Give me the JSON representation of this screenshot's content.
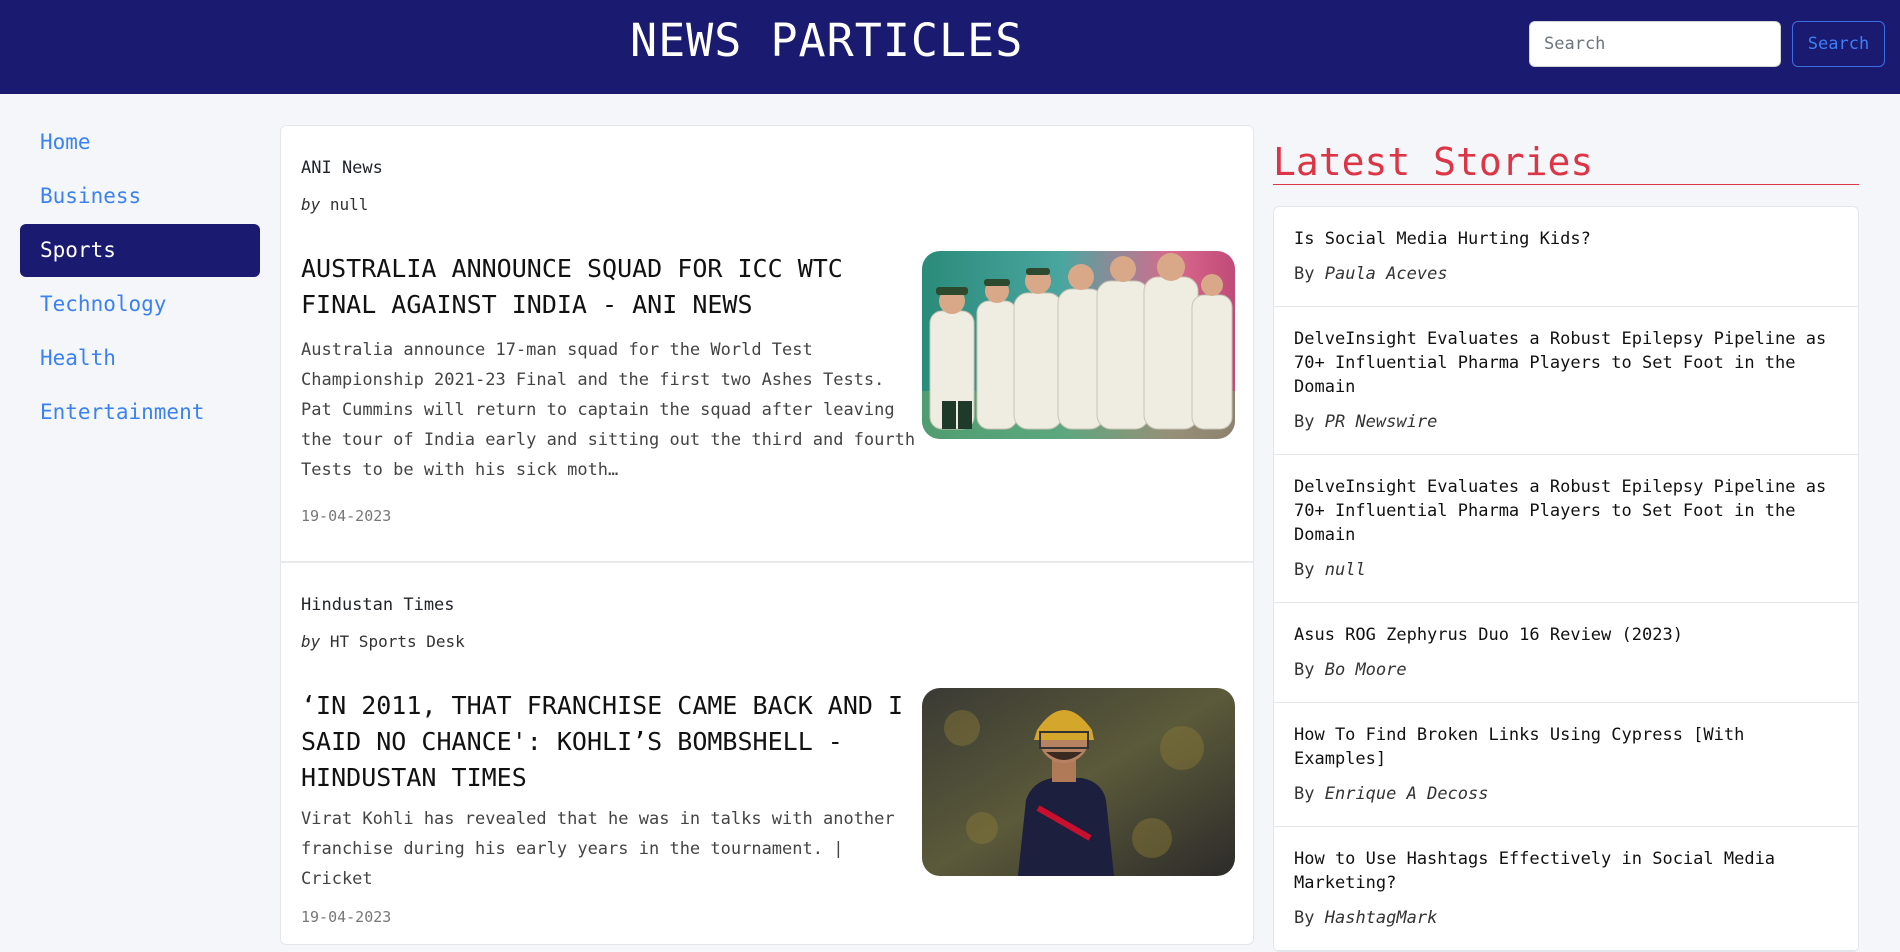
{
  "header": {
    "brand": "NEWS PARTICLES",
    "search_placeholder": "Search",
    "search_button": "Search"
  },
  "sidebar": {
    "items": [
      {
        "label": "Home"
      },
      {
        "label": "Business"
      },
      {
        "label": "Sports"
      },
      {
        "label": "Technology"
      },
      {
        "label": "Health"
      },
      {
        "label": "Entertainment"
      }
    ],
    "active": "Sports"
  },
  "articles": [
    {
      "source": "ANI News",
      "by_prefix": "by",
      "author": "null",
      "title": "AUSTRALIA ANNOUNCE SQUAD FOR ICC WTC FINAL AGAINST INDIA - ANI NEWS",
      "description": "Australia announce 17-man squad for the World Test Championship 2021-23 Final and the first two Ashes Tests. Pat Cummins will return to captain the squad after leaving the tour of India early and sitting out the third and fourth Tests to be with his sick moth…",
      "date": "19-04-2023"
    },
    {
      "source": "Hindustan Times",
      "by_prefix": "by",
      "author": "HT Sports Desk",
      "title": "‘IN 2011, THAT FRANCHISE CAME BACK AND I SAID NO CHANCE': KOHLI’S BOMBSHELL - HINDUSTAN TIMES",
      "description": "Virat Kohli has revealed that he was in talks with another franchise during his early years in the tournament. | Cricket",
      "date": "19-04-2023"
    }
  ],
  "latest": {
    "heading": "Latest Stories",
    "by_prefix": "By",
    "stories": [
      {
        "title": "Is Social Media Hurting Kids?",
        "author": "Paula Aceves"
      },
      {
        "title": "DelveInsight Evaluates a Robust Epilepsy Pipeline as 70+ Influential Pharma Players to Set Foot in the Domain",
        "author": "PR Newswire"
      },
      {
        "title": "DelveInsight Evaluates a Robust Epilepsy Pipeline as 70+ Influential Pharma Players to Set Foot in the Domain",
        "author": "null"
      },
      {
        "title": "Asus ROG Zephyrus Duo 16 Review (2023)",
        "author": "Bo Moore"
      },
      {
        "title": "How To Find Broken Links Using Cypress [With Examples]",
        "author": "Enrique A Decoss"
      },
      {
        "title": "How to Use Hashtags Effectively in Social Media Marketing?",
        "author": "HashtagMark"
      }
    ]
  },
  "colors": {
    "navbar": "#1a1a70",
    "link": "#3b82f0",
    "accent_red": "#dc3545"
  }
}
